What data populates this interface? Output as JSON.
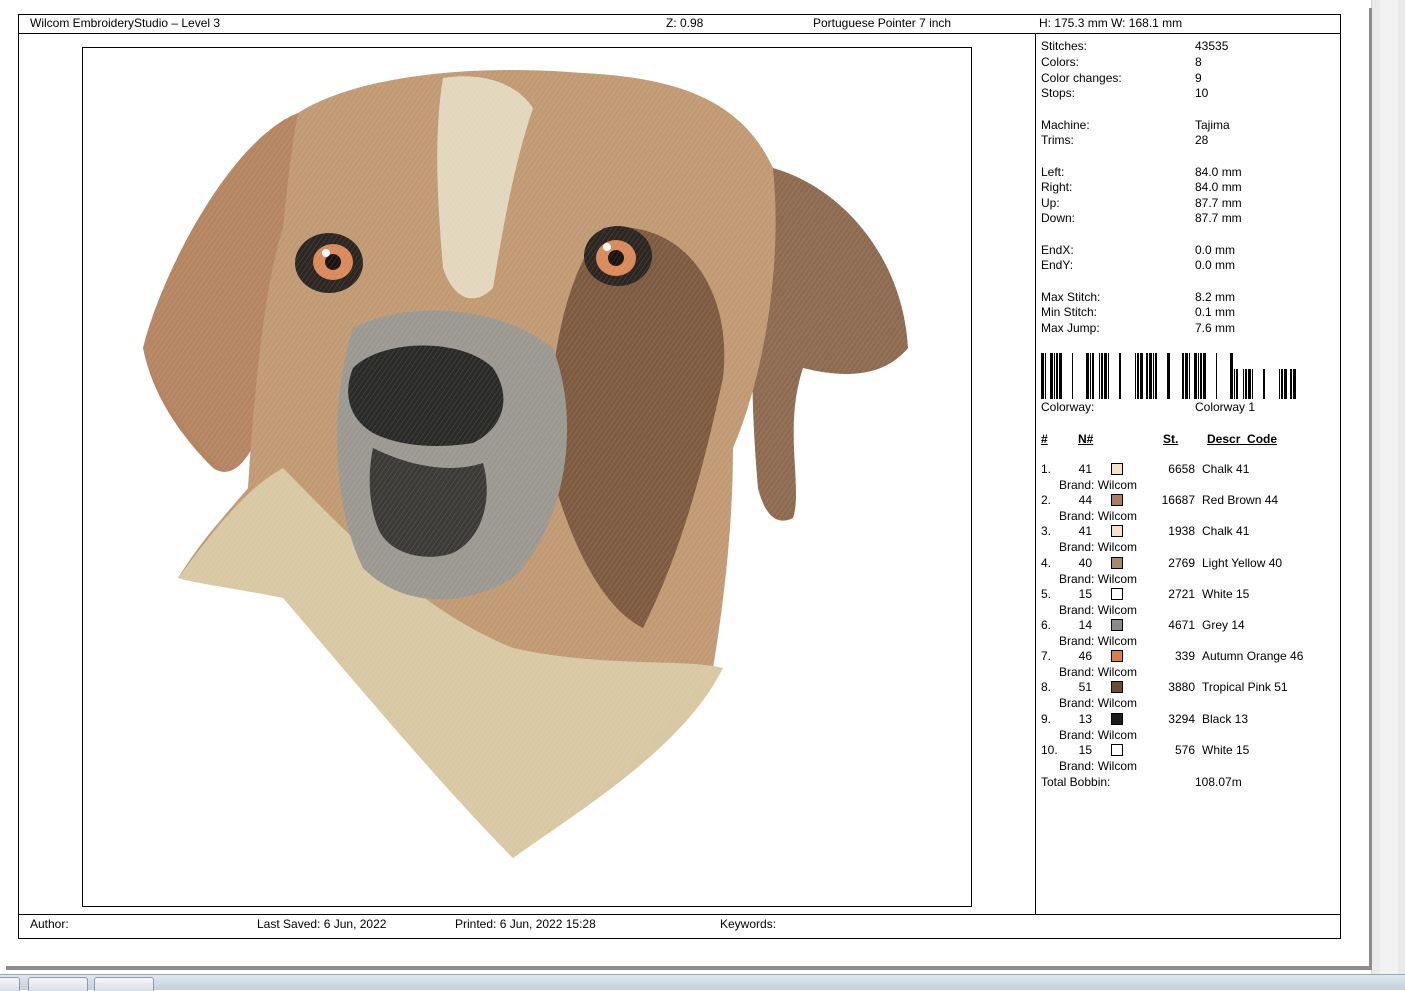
{
  "header": {
    "app_title": "Wilcom EmbroideryStudio – Level 3",
    "zoom": "Z: 0.98",
    "design_name": "Portuguese Pointer 7  inch",
    "dimensions": "H: 175.3 mm   W: 168.1 mm"
  },
  "stats": [
    {
      "label": "Stitches:",
      "value": "43535"
    },
    {
      "label": "Colors:",
      "value": "8"
    },
    {
      "label": "Color changes:",
      "value": "9"
    },
    {
      "label": "Stops:",
      "value": "10"
    },
    {
      "label": "Machine:",
      "value": "Tajima"
    },
    {
      "label": "Trims:",
      "value": "28"
    },
    {
      "label": "Left:",
      "value": "84.0 mm"
    },
    {
      "label": "Right:",
      "value": "84.0 mm"
    },
    {
      "label": "Up:",
      "value": "87.7 mm"
    },
    {
      "label": "Down:",
      "value": "87.7 mm"
    },
    {
      "label": "EndX:",
      "value": "0.0 mm"
    },
    {
      "label": "EndY:",
      "value": "0.0 mm"
    },
    {
      "label": "Max Stitch:",
      "value": "8.2 mm"
    },
    {
      "label": "Min Stitch:",
      "value": "0.1 mm"
    },
    {
      "label": "Max Jump:",
      "value": "7.6 mm"
    }
  ],
  "colorway": {
    "label": "Colorway:",
    "value": "Colorway 1"
  },
  "color_table": {
    "headers": {
      "num": "#",
      "n": "N#",
      "st": "St.",
      "desc": "Descr_Code"
    },
    "rows": [
      {
        "num": "1.",
        "n": "41",
        "color": "#f6e3c6",
        "st": "6658",
        "desc": "Chalk 41",
        "brand": "Brand: Wilcom"
      },
      {
        "num": "2.",
        "n": "44",
        "color": "#b07c5c",
        "st": "16687",
        "desc": "Red Brown 44",
        "brand": "Brand: Wilcom"
      },
      {
        "num": "3.",
        "n": "41",
        "color": "#f6e3c6",
        "st": "1938",
        "desc": "Chalk 41",
        "brand": "Brand: Wilcom"
      },
      {
        "num": "4.",
        "n": "40",
        "color": "#a8896c",
        "st": "2769",
        "desc": "Light Yellow 40",
        "brand": "Brand: Wilcom"
      },
      {
        "num": "5.",
        "n": "15",
        "color": "#ffffff",
        "st": "2721",
        "desc": "White 15",
        "brand": "Brand: Wilcom"
      },
      {
        "num": "6.",
        "n": "14",
        "color": "#8a8a8a",
        "st": "4671",
        "desc": "Grey 14",
        "brand": "Brand: Wilcom"
      },
      {
        "num": "7.",
        "n": "46",
        "color": "#e07a48",
        "st": "339",
        "desc": "Autumn Orange 46",
        "brand": "Brand: Wilcom"
      },
      {
        "num": "8.",
        "n": "51",
        "color": "#6e4b32",
        "st": "3880",
        "desc": "Tropical Pink 51",
        "brand": "Brand: Wilcom"
      },
      {
        "num": "9.",
        "n": "13",
        "color": "#1c1c1c",
        "st": "3294",
        "desc": "Black 13",
        "brand": "Brand: Wilcom"
      },
      {
        "num": "10.",
        "n": "15",
        "color": "#ffffff",
        "st": "576",
        "desc": "White 15",
        "brand": "Brand: Wilcom"
      }
    ]
  },
  "total_bobbin": {
    "label": "Total Bobbin:",
    "value": "108.07m"
  },
  "footer": {
    "author": "Author:",
    "last_saved": "Last Saved:  6 Jun, 2022",
    "printed": "Printed:  6 Jun, 2022 15:28",
    "keywords": "Keywords:"
  },
  "design_image": {
    "icon": "embroidery-dog-portrait"
  }
}
